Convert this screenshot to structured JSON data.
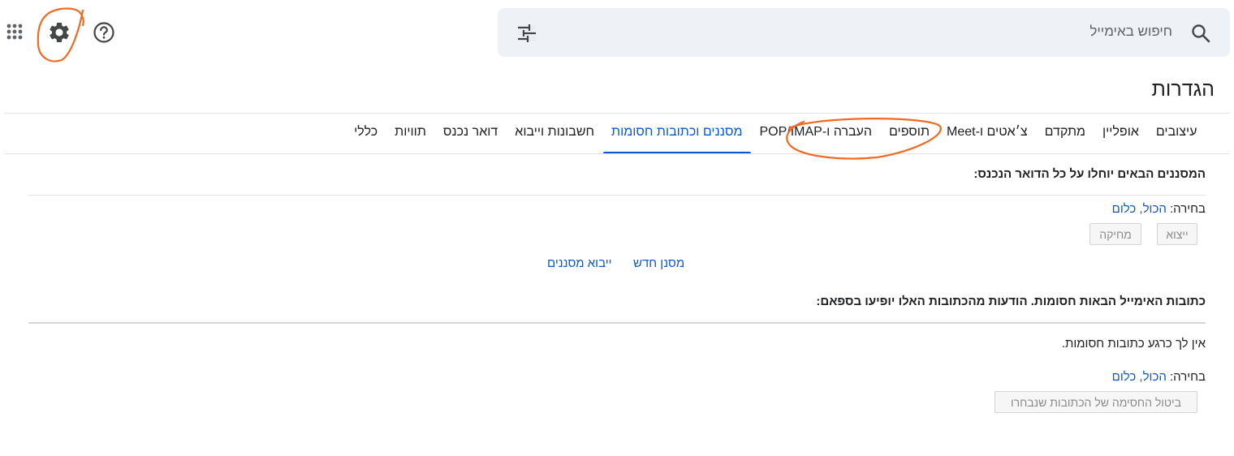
{
  "header": {
    "search_placeholder": "חיפוש באימייל"
  },
  "settings": {
    "title": "הגדרות",
    "tabs": [
      {
        "label": "כללי"
      },
      {
        "label": "תוויות"
      },
      {
        "label": "דואר נכנס"
      },
      {
        "label": "חשבונות וייבוא"
      },
      {
        "label": "מסננים וכתובות חסומות",
        "active": true
      },
      {
        "label": "העברה ו-POP/IMAP"
      },
      {
        "label": "תוספים"
      },
      {
        "label": "צ׳אטים ו-Meet"
      },
      {
        "label": "מתקדם"
      },
      {
        "label": "אופליין"
      },
      {
        "label": "עיצובים"
      }
    ]
  },
  "filters": {
    "heading": "המסננים הבאים יוחלו על כל הדואר הנכנס:",
    "select_label": "בחירה:",
    "select_all": "הכול",
    "select_none": "כלום",
    "separator": ", ",
    "export_button": "ייצוא",
    "delete_button": "מחיקה",
    "new_filter_link": "מסנן חדש",
    "import_filters_link": "ייבוא מסננים"
  },
  "blocked": {
    "heading": "כתובות האימייל הבאות חסומות. הודעות מהכתובות האלו יופיעו בספאם:",
    "empty_text": "אין לך כרגע כתובות חסומות.",
    "select_label": "בחירה:",
    "select_all": "הכול",
    "select_none": "כלום",
    "separator": ", ",
    "unblock_button": "ביטול החסימה של הכתובות שנבחרו"
  },
  "colors": {
    "accent": "#0b57d0",
    "annotation": "#f26a21",
    "search_bg": "#eef1f6"
  },
  "icons": {
    "apps": "apps-grid-icon",
    "settings": "gear-icon",
    "help": "help-icon",
    "search": "search-icon",
    "search_options": "tune-icon"
  }
}
